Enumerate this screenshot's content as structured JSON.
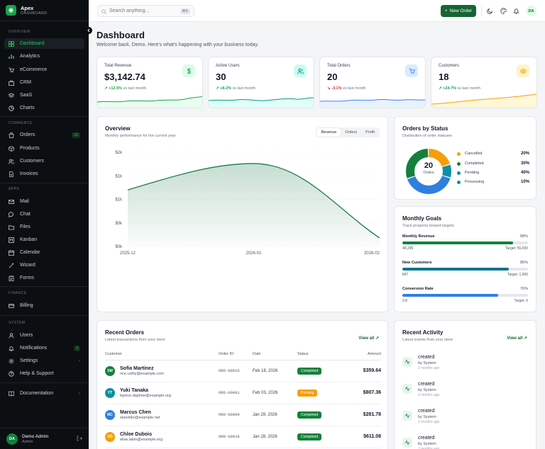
{
  "brand": {
    "name": "Apex",
    "subtitle": "DASHBOARD"
  },
  "nav": {
    "overview_label": "OVERVIEW",
    "commerce_label": "COMMERCE",
    "apps_label": "APPS",
    "finance_label": "FINANCE",
    "system_label": "SYSTEM",
    "items": [
      {
        "label": "Dashboard"
      },
      {
        "label": "Analytics"
      },
      {
        "label": "eCommerce"
      },
      {
        "label": "CRM"
      },
      {
        "label": "SaaS"
      },
      {
        "label": "Charts"
      },
      {
        "label": "Orders",
        "badge": "12"
      },
      {
        "label": "Products"
      },
      {
        "label": "Customers"
      },
      {
        "label": "Invoices"
      },
      {
        "label": "Mail"
      },
      {
        "label": "Chat"
      },
      {
        "label": "Files"
      },
      {
        "label": "Kanban"
      },
      {
        "label": "Calendar"
      },
      {
        "label": "Wizard"
      },
      {
        "label": "Forms"
      },
      {
        "label": "Billing"
      },
      {
        "label": "Users"
      },
      {
        "label": "Notifications",
        "badge": "3"
      },
      {
        "label": "Settings"
      },
      {
        "label": "Help & Support"
      },
      {
        "label": "Documentation"
      }
    ]
  },
  "user": {
    "initials": "DA",
    "name": "Demo Admin",
    "role": "Admin"
  },
  "topbar": {
    "search_placeholder": "Search anything...",
    "shortcut": "⌘K",
    "new_order_label": "New Order",
    "avatar_initials": "DA"
  },
  "page": {
    "title": "Dashboard",
    "subtitle": "Welcome back, Demo. Here's what's happening with your business today."
  },
  "stats": [
    {
      "label": "Total Revenue",
      "value": "$3,142.74",
      "delta": "+12.5%",
      "delta_note": "vs last month",
      "color": "#16a34a"
    },
    {
      "label": "Active Users",
      "value": "30",
      "delta": "+8.2%",
      "delta_note": "vs last month",
      "color": "#0d9488"
    },
    {
      "label": "Total Orders",
      "value": "20",
      "delta": "-3.1%",
      "delta_note": "vs last month",
      "color": "#3b82f6"
    },
    {
      "label": "Customers",
      "value": "18",
      "delta": "+24.7%",
      "delta_note": "vs last month",
      "color": "#f59e0b"
    }
  ],
  "overview": {
    "title": "Overview",
    "subtitle": "Monthly performance for the current year",
    "tabs": [
      "Revenue",
      "Orders",
      "Profit"
    ]
  },
  "chart_data": {
    "type": "area",
    "x": [
      "2025-12",
      "2026-01",
      "2026-02"
    ],
    "yticks": [
      "$2k",
      "$1k",
      "$1k",
      "$0k",
      "$0k"
    ],
    "ylim": [
      0,
      2000
    ],
    "series": [
      {
        "values": [
          1200,
          1760,
          180
        ]
      }
    ],
    "color": "#1f7a4a",
    "grid": true
  },
  "status": {
    "title": "Orders by Status",
    "subtitle": "Distribution of order statuses",
    "center_value": "20",
    "center_label": "Orders",
    "items": [
      {
        "name": "Cancelled",
        "pct": "20%",
        "value": 20,
        "color": "#f59e0b"
      },
      {
        "name": "Completed",
        "pct": "30%",
        "value": 30,
        "color": "#15803d"
      },
      {
        "name": "Pending",
        "pct": "40%",
        "value": 40,
        "color": "#2f7fe0"
      },
      {
        "name": "Processing",
        "pct": "10%",
        "value": 10,
        "color": "#0e8fa3"
      }
    ]
  },
  "goals": {
    "title": "Monthly Goals",
    "subtitle": "Track progress toward targets",
    "items": [
      {
        "name": "Monthly Revenue",
        "pct": "88%",
        "value": 0.88,
        "current": "48,295",
        "target": "Target: 55,000",
        "color": "#15803d"
      },
      {
        "name": "New Customers",
        "pct": "85%",
        "value": 0.85,
        "current": "847",
        "target": "Target: 1,000",
        "color": "#0e7490"
      },
      {
        "name": "Conversion Rate",
        "pct": "76%",
        "value": 0.76,
        "current": "3.8",
        "target": "Target: 5",
        "color": "#2f7fe0"
      }
    ]
  },
  "recent_orders": {
    "title": "Recent Orders",
    "subtitle": "Latest transactions from your store",
    "view_all": "View all",
    "columns": [
      "Customer",
      "Order ID",
      "Date",
      "Status",
      "Amount"
    ],
    "rows": [
      {
        "initials": "SM",
        "name": "Sofia Martinez",
        "email": "rice.cathy@example.com",
        "order_id": "ORD-00015",
        "date": "Feb 18, 2026",
        "status": "Completed",
        "amount": "$359.64",
        "avatar_color": "#15803d",
        "status_color": "#15803d"
      },
      {
        "initials": "YT",
        "name": "Yuki Tanaka",
        "email": "leprice.daphne@example.org",
        "order_id": "ORD-00001",
        "date": "Feb 03, 2026",
        "status": "Pending",
        "amount": "$807.36",
        "avatar_color": "#0e8fa3",
        "status_color": "#f59e0b"
      },
      {
        "initials": "MC",
        "name": "Marcus Chen",
        "email": "zkeebler@example.net",
        "order_id": "ORD-00009",
        "date": "Jan 29, 2026",
        "status": "Completed",
        "amount": "$281.78",
        "avatar_color": "#2f7fe0",
        "status_color": "#15803d"
      },
      {
        "initials": "CD",
        "name": "Chloe Dubois",
        "email": "elise.lakin@example.org",
        "order_id": "ORD-00018",
        "date": "Jan 28, 2026",
        "status": "Completed",
        "amount": "$611.08",
        "avatar_color": "#f59e0b",
        "status_color": "#15803d"
      }
    ]
  },
  "activity": {
    "title": "Recent Activity",
    "subtitle": "Latest events from your store",
    "view_all": "View all",
    "items": [
      {
        "title": "created",
        "by": "by System",
        "time": "2 months ago"
      },
      {
        "title": "created",
        "by": "by System",
        "time": "2 months ago"
      },
      {
        "title": "created",
        "by": "by System",
        "time": "2 months ago"
      },
      {
        "title": "created",
        "by": "by System",
        "time": "2 months ago"
      }
    ]
  }
}
